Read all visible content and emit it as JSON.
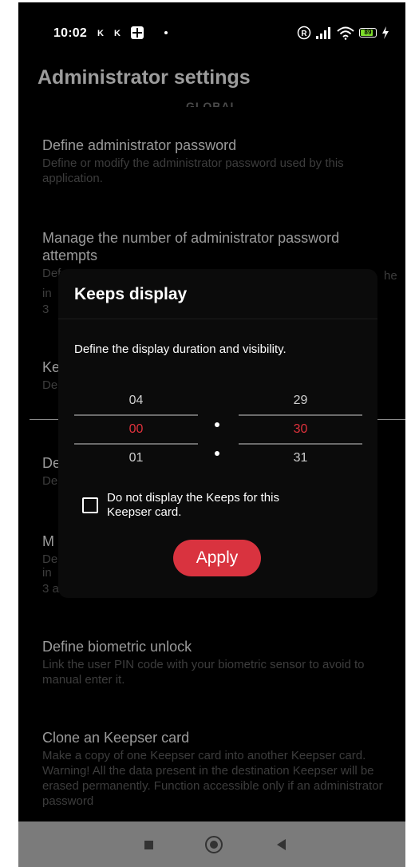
{
  "status_bar": {
    "time": "10:02",
    "notification_k1": "K",
    "notification_k2": "K",
    "battery_level": "89",
    "battery_fraction": 0.89,
    "colors": {
      "battery": "#7ddc2a"
    }
  },
  "page": {
    "title": "Administrator settings",
    "section_header": "GLOBAL",
    "settings": [
      {
        "title": "Define administrator password",
        "description": "Define or modify the administrator password used by this application."
      },
      {
        "title": "Manage the number of administrator password attempts",
        "description": "Def"
      },
      {
        "title": "Ke",
        "description": "De"
      },
      {
        "title": "De",
        "description": "De"
      },
      {
        "title": "M",
        "description": "De"
      },
      {
        "title": "Define biometric unlock",
        "description": "Link the user PIN code with your biometric sensor to avoid to manual enter it."
      },
      {
        "title": "Clone an Keepser card",
        "description": "Make a copy of one Keepser card into another Keepser card. Warning! All the data present in the destination Keepser will be erased permanently. Function accessible only if an administrator password"
      }
    ],
    "partial_text": {
      "left_in_1": "in",
      "left_3_1": "3",
      "right_he": "he",
      "left_in_2": "in",
      "left_3a": "3 a"
    }
  },
  "dialog": {
    "title": "Keeps display",
    "subtitle": "Define the display duration and visibility.",
    "left_picker": {
      "prev": "04",
      "selected": "00",
      "next": "01"
    },
    "right_picker": {
      "prev": "29",
      "selected": "30",
      "next": "31"
    },
    "checkbox_label": "Do not display the Keeps for this Keepser card.",
    "checkbox_checked": false,
    "apply_label": "Apply",
    "colors": {
      "accent": "#d9333f",
      "selected_value": "#e0323c"
    }
  },
  "nav_bar": {
    "icons": [
      "recent-apps-icon",
      "home-icon",
      "back-icon"
    ]
  }
}
